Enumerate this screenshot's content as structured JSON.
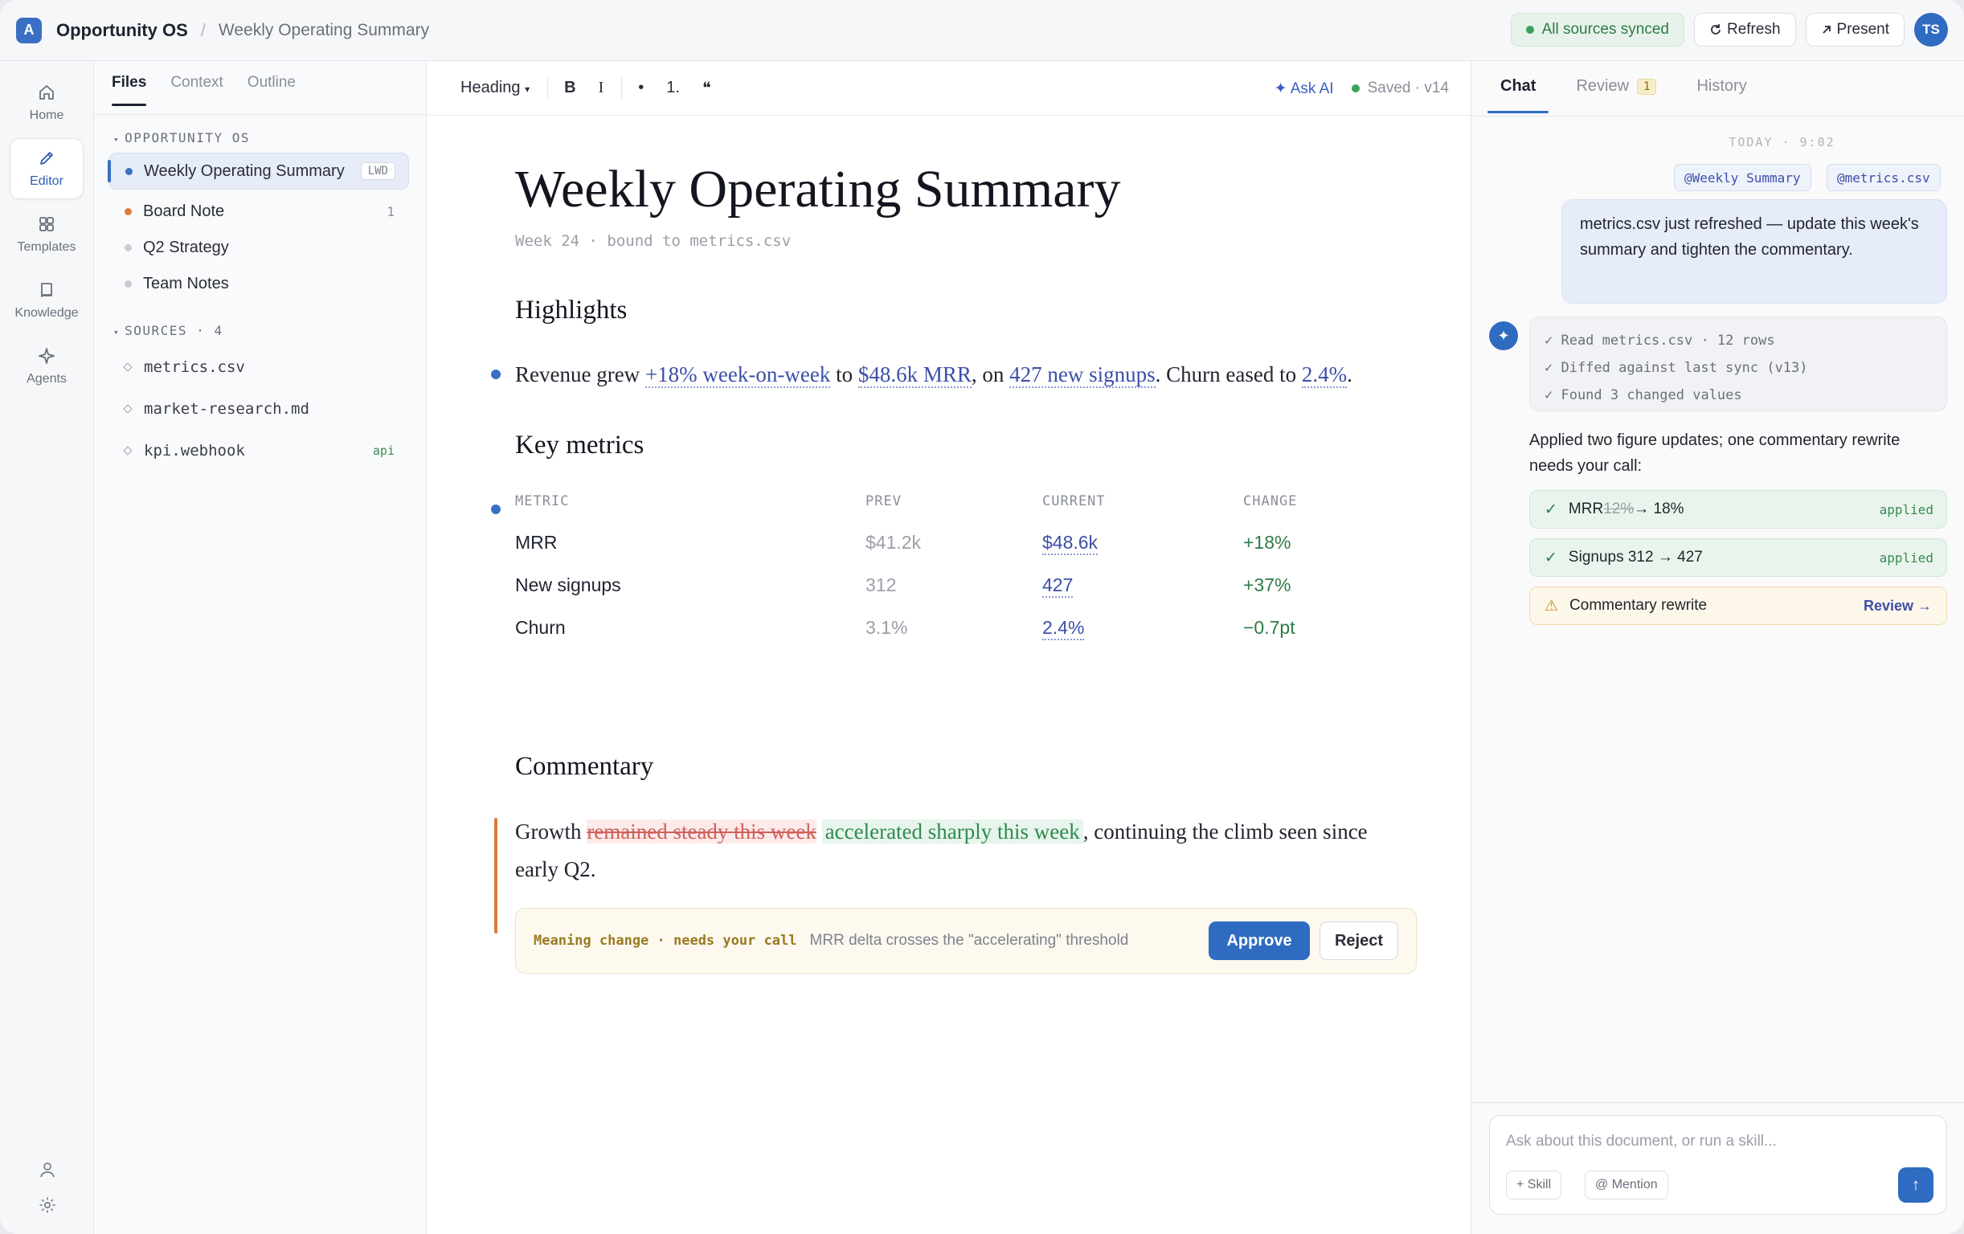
{
  "topbar": {
    "logo_letter": "A",
    "app_name": "Opportunity OS",
    "separator": "/",
    "doc_title": "Weekly Operating Summary",
    "sync_status": "All sources synced",
    "refresh_label": "Refresh",
    "present_label": "Present",
    "avatar_initials": "TS"
  },
  "rail": {
    "items": [
      {
        "label": "Home",
        "icon": "home-icon"
      },
      {
        "label": "Editor",
        "icon": "pencil-icon"
      },
      {
        "label": "Templates",
        "icon": "grid-icon"
      },
      {
        "label": "Knowledge",
        "icon": "book-icon"
      },
      {
        "label": "Agents",
        "icon": "sparkle-icon"
      }
    ],
    "active": "Editor"
  },
  "files_panel": {
    "tabs": [
      "Files",
      "Context",
      "Outline"
    ],
    "active_tab": "Files",
    "workspace_heading": "OPPORTUNITY OS",
    "docs": [
      {
        "name": "Weekly Operating Summary",
        "tag": "LWD",
        "dot": "#3a6fc4"
      },
      {
        "name": "Board Note",
        "count": "1",
        "dot": "#e07a3c"
      },
      {
        "name": "Q2 Strategy",
        "dot": "#c9ccd3"
      },
      {
        "name": "Team Notes",
        "dot": "#c9ccd3"
      }
    ],
    "sources_heading": "SOURCES · 4",
    "sources": [
      {
        "name": "metrics.csv"
      },
      {
        "name": "market-research.md"
      },
      {
        "name": "kpi.webhook",
        "tag": "api"
      }
    ]
  },
  "toolbar": {
    "style_select": "Heading",
    "bold": "B",
    "italic": "I",
    "bullet": "•",
    "numbered": "1.",
    "quote": "❝",
    "ask_ai": "✦ Ask AI",
    "saved": "Saved · v14"
  },
  "doc": {
    "title": "Weekly Operating Summary",
    "subtitle": "Week 24 · bound to metrics.csv",
    "highlights_heading": "Highlights",
    "highlight": {
      "p1": "Revenue grew ",
      "l1": "+18% week-on-week",
      "p2": " to ",
      "l2": "$48.6k MRR",
      "p3": ", on ",
      "l3": "427 new signups",
      "p4": ". Churn eased to ",
      "l4": "2.4%",
      "p5": "."
    },
    "metrics_heading": "Key metrics",
    "table": {
      "headers": [
        "METRIC",
        "PREV",
        "CURRENT",
        "CHANGE"
      ],
      "rows": [
        {
          "metric": "MRR",
          "prev": "$41.2k",
          "current": "$48.6k",
          "change": "+18%"
        },
        {
          "metric": "New signups",
          "prev": "312",
          "current": "427",
          "change": "+37%"
        },
        {
          "metric": "Churn",
          "prev": "3.1%",
          "current": "2.4%",
          "change": "−0.7pt"
        }
      ]
    },
    "commentary_heading": "Commentary",
    "commentary": {
      "start": "Growth ",
      "deleted": "remained steady this week",
      "inserted": "accelerated sharply this week",
      "rest": ", continuing the climb seen since",
      "line2": "early Q2."
    },
    "callout": {
      "label": "Meaning change · needs your call",
      "message": "MRR delta crosses the \"accelerating\" threshold",
      "approve": "Approve",
      "reject": "Reject"
    }
  },
  "chat": {
    "tabs": [
      {
        "label": "Chat"
      },
      {
        "label": "Review",
        "badge": "1"
      },
      {
        "label": "History"
      }
    ],
    "active_tab": "Chat",
    "timestamp": "TODAY · 9:02",
    "chips": [
      "@Weekly Summary",
      "@metrics.csv"
    ],
    "user_message": "metrics.csv just refreshed — update this week's summary and tighten the commentary.",
    "ai_icon": "✦",
    "steps": [
      "✓ Read metrics.csv · 12 rows",
      "✓ Diffed against last sync (v13)",
      "✓ Found 3 changed values"
    ],
    "ai_text": "Applied two figure updates; one commentary rewrite needs your call:",
    "actions": [
      {
        "icon": "✓",
        "label_a": "MRR ",
        "old": "12%",
        "label_b": " → 18%",
        "status": "applied"
      },
      {
        "icon": "✓",
        "label": "Signups 312 → 427",
        "status": "applied"
      },
      {
        "icon": "⚠",
        "label": "Commentary rewrite",
        "link": "Review →"
      }
    ],
    "composer": {
      "placeholder": "Ask about this document, or run a skill...",
      "skill": "+ Skill",
      "mention": "@ Mention",
      "send_icon": "↑"
    }
  }
}
